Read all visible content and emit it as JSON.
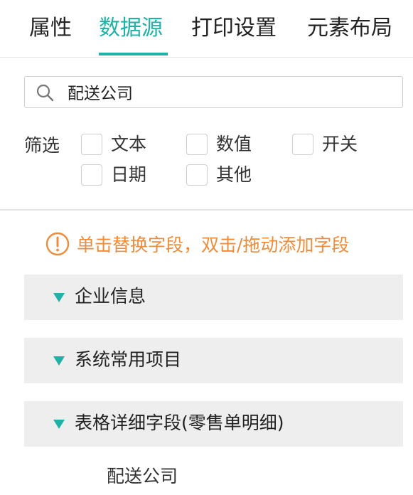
{
  "tabs": [
    {
      "label": "属性"
    },
    {
      "label": "数据源"
    },
    {
      "label": "打印设置"
    },
    {
      "label": "元素布局"
    }
  ],
  "accent_color": "#1eb3a6",
  "hint_color": "#f08b3a",
  "search": {
    "value": "配送公司",
    "icon": "search-icon"
  },
  "filter": {
    "label": "筛选",
    "options": [
      {
        "label": "文本",
        "checked": false
      },
      {
        "label": "数值",
        "checked": false
      },
      {
        "label": "开关",
        "checked": false
      },
      {
        "label": "日期",
        "checked": false
      },
      {
        "label": "其他",
        "checked": false
      }
    ]
  },
  "hint": {
    "text": "单击替换字段，双击/拖动添加字段",
    "icon": "info-circle-icon"
  },
  "groups": [
    {
      "label": "企业信息",
      "expanded": true
    },
    {
      "label": "系统常用项目",
      "expanded": true
    },
    {
      "label": "表格详细字段(零售单明细)",
      "expanded": true
    }
  ],
  "fields": [
    {
      "label": "配送公司"
    }
  ]
}
